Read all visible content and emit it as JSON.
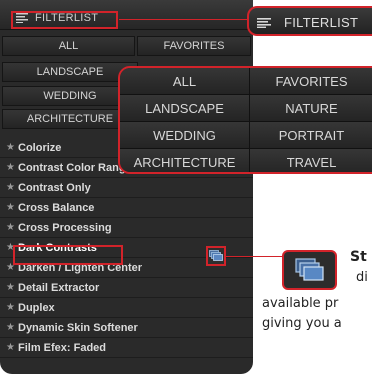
{
  "panel": {
    "title": "FILTERLIST",
    "categories": [
      "ALL",
      "FAVORITES",
      "LANDSCAPE",
      "WEDDING",
      "ARCHITECTURE"
    ],
    "filters": [
      "Colorize",
      "Contrast Color Range",
      "Contrast Only",
      "Cross Balance",
      "Cross Processing",
      "Dark Contrasts",
      "Darken / Lighten Center",
      "Detail Extractor",
      "Duplex",
      "Dynamic Skin Softener",
      "Film Efex: Faded"
    ],
    "selected_filter": "Dark Contrasts"
  },
  "callout_title": {
    "title": "FILTERLIST"
  },
  "callout_categories": {
    "rows": [
      [
        "ALL",
        "FAVORITES"
      ],
      [
        "LANDSCAPE",
        "NATURE"
      ],
      [
        "WEDDING",
        "PORTRAIT"
      ],
      [
        "ARCHITECTURE",
        "TRAVEL"
      ]
    ]
  },
  "text": {
    "line1": "St",
    "line2": "di",
    "line3": "available pr",
    "line4": "giving you a"
  },
  "colors": {
    "highlight": "#d2232a",
    "panel_bg": "#2a2a2a"
  },
  "icons": {
    "header": "list-icon",
    "stack": "stacked-windows-icon",
    "row": "star-icon"
  }
}
